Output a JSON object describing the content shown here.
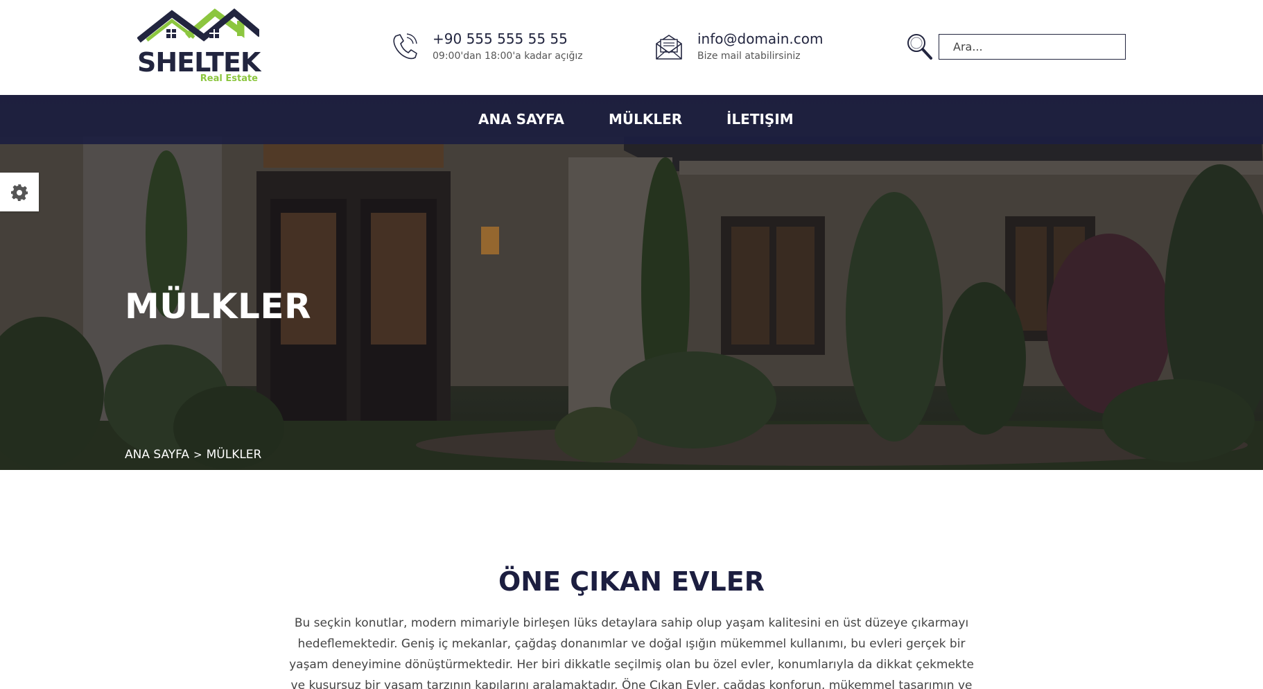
{
  "brand": {
    "name": "SHELTEK",
    "tagline": "Real Estate",
    "roof_color": "#22253f",
    "accent_color": "#8cc63f"
  },
  "header": {
    "phone": {
      "icon": "phone-icon",
      "number": "+90 555 555 55 55",
      "hours": "09:00'dan 18:00'a kadar açığız"
    },
    "email": {
      "icon": "mail-icon",
      "address": "info@domain.com",
      "note": "Bize mail atabilirsiniz"
    },
    "search": {
      "icon": "search-icon",
      "placeholder": "Ara..."
    }
  },
  "nav": {
    "items": [
      {
        "label": "ANA SAYFA"
      },
      {
        "label": "MÜLKLER"
      },
      {
        "label": "İLETIŞIM"
      }
    ],
    "background": "#1c1e40"
  },
  "hero": {
    "title": "MÜLKLER",
    "breadcrumb": {
      "home": "ANA SAYFA",
      "separator": ">",
      "current": "MÜLKLER"
    }
  },
  "settings": {
    "icon": "gear-icon"
  },
  "featured": {
    "title": "ÖNE ÇIKAN EVLER",
    "description": "Bu seçkin konutlar, modern mimariyle birleşen lüks detaylara sahip olup yaşam kalitesini en üst düzeye çıkarmayı hedeflemektedir. Geniş iç mekanlar, çağdaş donanımlar ve doğal ışığın mükemmel kullanımı, bu evleri gerçek bir yaşam deneyimine dönüştürmektedir. Her biri dikkatle seçilmiş olan bu özel evler, konumlarıyla da dikkat çekmekte ve kusursuz bir yaşam tarzının kapılarını aralamaktadır. Öne Çıkan Evler, çağdaş konforun, mükemmel tasarımın ve"
  }
}
